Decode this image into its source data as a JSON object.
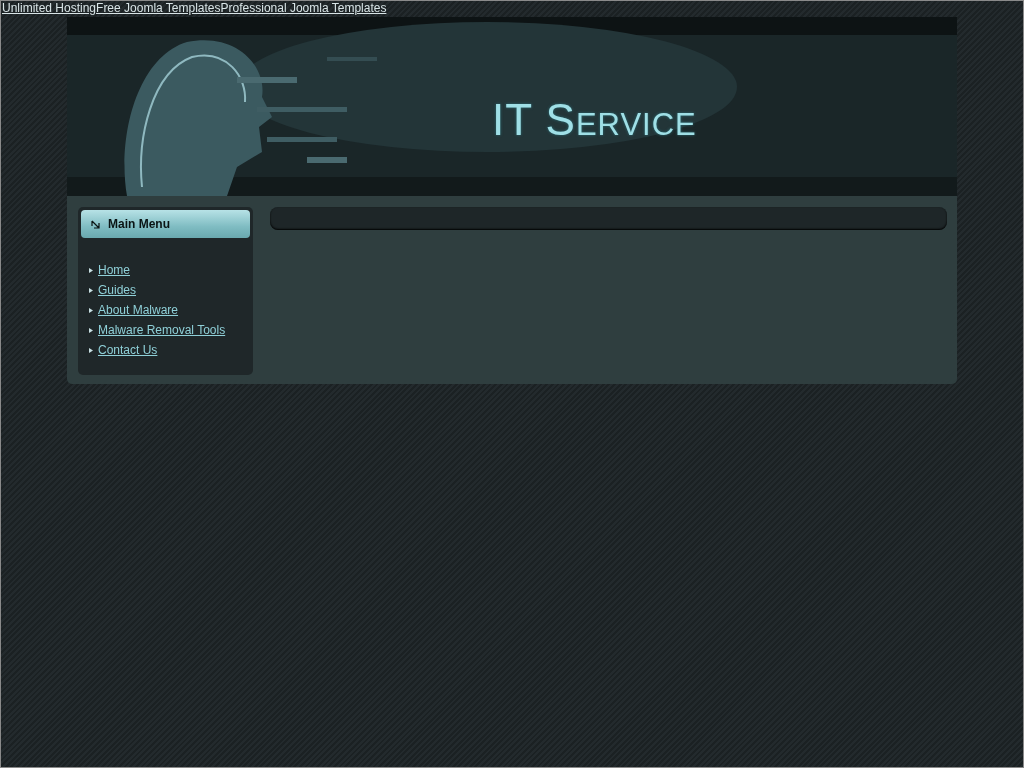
{
  "top_links": [
    "Unlimited Hosting",
    "Free Joomla Templates",
    "Professional Joomla Templates"
  ],
  "header": {
    "title": "IT Service"
  },
  "sidebar": {
    "title": "Main Menu",
    "items": [
      "Home",
      "Guides",
      "About Malware",
      "Malware Removal Tools",
      "Contact Us"
    ]
  }
}
